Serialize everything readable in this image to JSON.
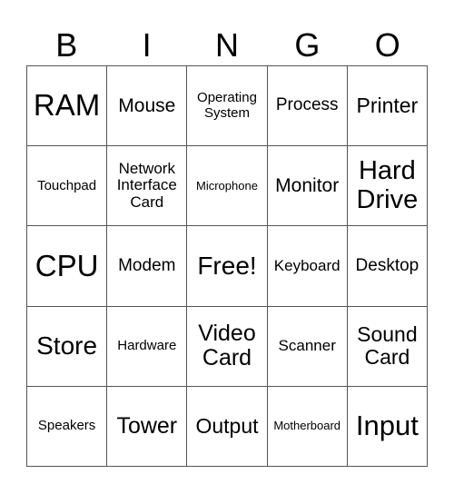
{
  "header": [
    "B",
    "I",
    "N",
    "G",
    "O"
  ],
  "cells": [
    [
      "RAM",
      "Mouse",
      "Operating System",
      "Process",
      "Printer"
    ],
    [
      "Touchpad",
      "Network Interface Card",
      "Microphone",
      "Monitor",
      "Hard Drive"
    ],
    [
      "CPU",
      "Modem",
      "Free!",
      "Keyboard",
      "Desktop"
    ],
    [
      "Store",
      "Hardware",
      "Video Card",
      "Scanner",
      "Sound Card"
    ],
    [
      "Speakers",
      "Tower",
      "Output",
      "Motherboard",
      "Input"
    ]
  ]
}
